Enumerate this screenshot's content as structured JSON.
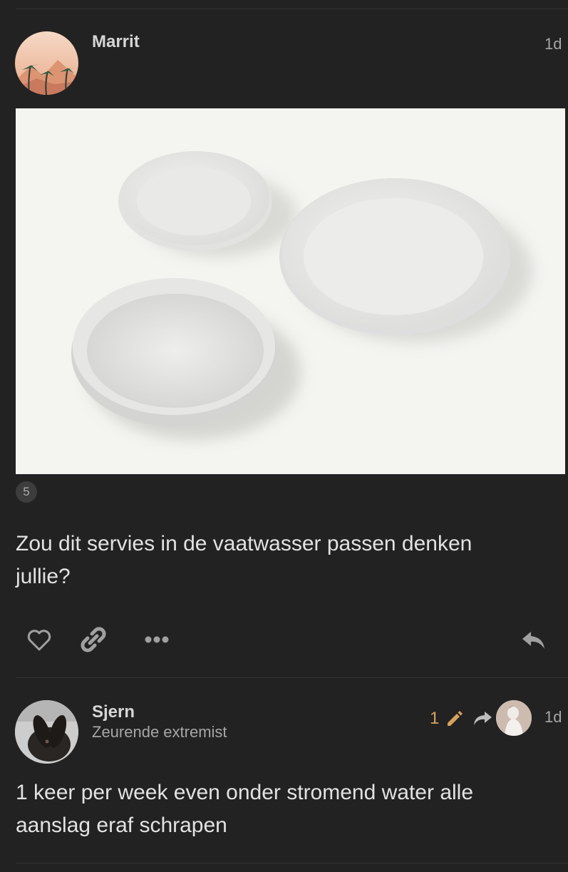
{
  "post1": {
    "username": "Marrit",
    "date": "1d",
    "image_count": "5",
    "text": "Zou dit servies in de vaatwasser passen denken jullie?",
    "avatar_icon": "palm-trees-avatar",
    "image_subject": "white-plates-photo"
  },
  "actions": {
    "like_icon": "heart-icon",
    "link_icon": "link-icon",
    "more_icon": "ellipsis-icon",
    "reply_icon": "reply-icon"
  },
  "post2": {
    "username": "Sjern",
    "user_title": "Zeurende extremist",
    "edit_count": "1",
    "date": "1d",
    "text": "1 keer per week even onder stromend water alle aanslag eraf schrapen",
    "avatar_icon": "rabbit-avatar",
    "reply_to_avatar_icon": "reply-to-user-avatar"
  },
  "colors": {
    "background": "#222222",
    "text": "#e2e2e2",
    "muted": "#a6a6a6",
    "edit_accent": "#d8a15e"
  }
}
